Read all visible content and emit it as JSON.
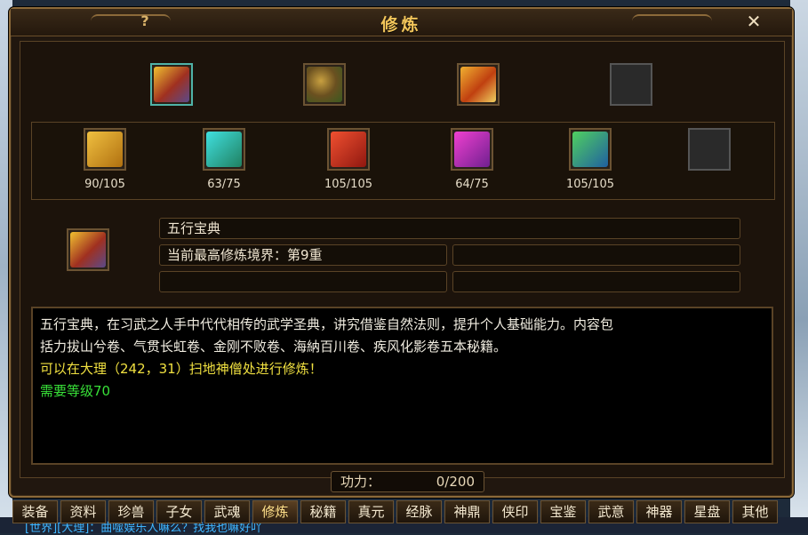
{
  "window": {
    "title": "修炼",
    "help_label": "?",
    "close_label": "✕"
  },
  "top_slots": [
    {
      "icon": "five-elements-book-icon",
      "selected": true
    },
    {
      "icon": "scroll-bundle-icon"
    },
    {
      "icon": "treasure-chest-icon"
    },
    {
      "icon": "empty-slot"
    }
  ],
  "books": [
    {
      "icon": "yellow-book-icon",
      "color": "#d8a020",
      "count": "90/105"
    },
    {
      "icon": "cyan-book-icon",
      "color": "#20b8c0",
      "count": "63/75"
    },
    {
      "icon": "red-book-icon",
      "color": "#d83020",
      "count": "105/105"
    },
    {
      "icon": "purple-book-icon",
      "color": "#c030c0",
      "count": "64/75"
    },
    {
      "icon": "green-book-icon",
      "color": "#30a040",
      "count": "105/105"
    },
    {
      "icon": "empty-slot",
      "color": "#2a2a2a",
      "count": ""
    }
  ],
  "detail": {
    "name": "五行宝典",
    "realm": "当前最高修炼境界：第9重",
    "extra1": "",
    "extra2": "",
    "extra3": ""
  },
  "description": {
    "line1": "五行宝典，在习武之人手中代代相传的武学圣典，讲究借鉴自然法则，提升个人基础能力。内容包",
    "line2": "括力拔山兮卷、气贯长虹卷、金刚不败卷、海納百川卷、疾风化影卷五本秘籍。",
    "location": "可以在大理（242，31）扫地神僧处进行修炼！",
    "requirement": "需要等级70"
  },
  "power": {
    "label": "功力：",
    "value": "0/200"
  },
  "tabs": [
    "装备",
    "资料",
    "珍兽",
    "子女",
    "武魂",
    "修炼",
    "秘籍",
    "真元",
    "经脉",
    "神鼎",
    "侠印",
    "宝鉴",
    "武意",
    "神器",
    "星盘",
    "其他"
  ],
  "active_tab": "修炼",
  "chat_line": "[世界][大理]：曲噬娱乐人嘛么？找我也嘛好吖",
  "colors": {
    "accent": "#f2c55a",
    "border": "#8c6a3a",
    "location_text": "#f0e040",
    "requirement_text": "#38e038"
  }
}
